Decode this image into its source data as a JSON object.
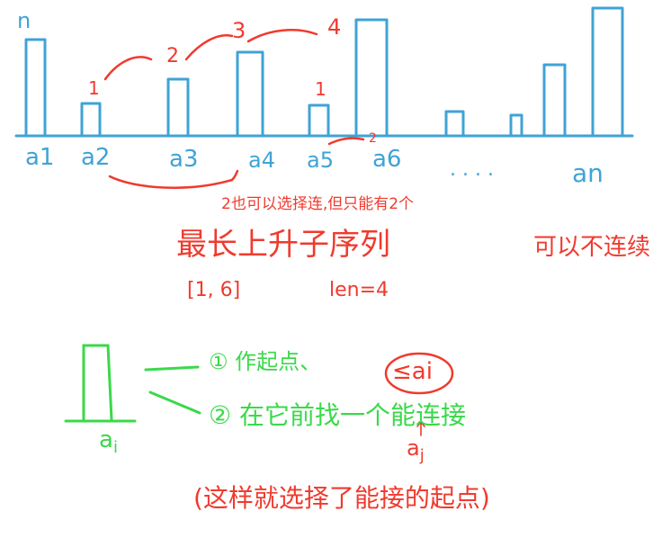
{
  "colors": {
    "blue": "#3fa3d6",
    "red": "#f03a2e",
    "green": "#3ad94a"
  },
  "bars": [
    {
      "label": "a1",
      "height_label": "n"
    },
    {
      "label": "a2",
      "height_label": "1"
    },
    {
      "label": "a3",
      "height_label": "2"
    },
    {
      "label": "a4",
      "height_label": "3"
    },
    {
      "label": "a5",
      "height_label": "1"
    },
    {
      "label": "a6",
      "height_label": "4"
    },
    {
      "label": "",
      "height_label": ""
    },
    {
      "label": "",
      "height_label": ""
    },
    {
      "label": "",
      "height_label": ""
    },
    {
      "label": "an",
      "height_label": ""
    }
  ],
  "extra_label": "2",
  "dots": ". . . .",
  "bracket_note": "2也可以选择连,但只能有2个",
  "heading_longest": "最长上升子序列",
  "heading_discontinuous": "可以不连续",
  "example_interval": "[1, 6]",
  "example_len": "len=4",
  "ai": {
    "base": "a",
    "sub": "i"
  },
  "options": [
    "① 作起点、",
    "② 在它前找一个能连接"
  ],
  "condition": "≤ai",
  "aj": {
    "base": "a",
    "sub": "j"
  },
  "footnote": "(这样就选择了能接的起点)"
}
